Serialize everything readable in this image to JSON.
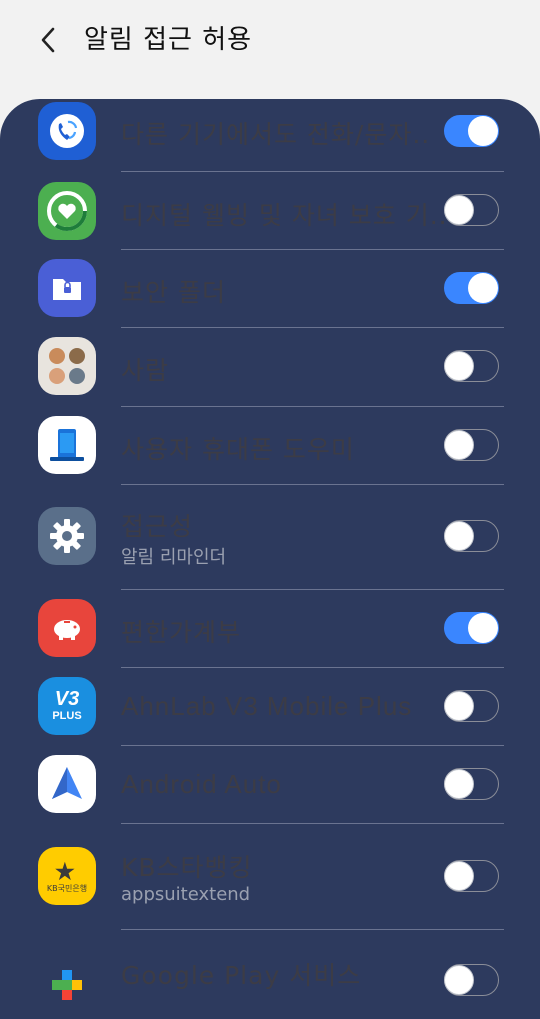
{
  "header": {
    "title": "알림 접근 허용"
  },
  "apps": [
    {
      "name": "다른 기기에서도 전화/문자..",
      "sub": "",
      "enabled": true,
      "icon": "phone-sync-icon",
      "icon_bg": "#1f5fd4"
    },
    {
      "name": "디지털 웰빙 및 자녀 보호 기..",
      "sub": "",
      "enabled": false,
      "icon": "digital-wellbeing-icon",
      "icon_bg": "#4caf50"
    },
    {
      "name": "보안 폴더",
      "sub": "",
      "enabled": true,
      "icon": "secure-folder-icon",
      "icon_bg": "#4a5fd6"
    },
    {
      "name": "사람",
      "sub": "",
      "enabled": false,
      "icon": "people-icon",
      "icon_bg": "#e8e4de"
    },
    {
      "name": "사용자 휴대폰 도우미",
      "sub": "",
      "enabled": false,
      "icon": "phone-helper-icon",
      "icon_bg": "#ffffff"
    },
    {
      "name": "접근성",
      "sub": "알림 리마인더",
      "enabled": false,
      "icon": "settings-gear-icon",
      "icon_bg": "#5a6f8a"
    },
    {
      "name": "편한가계부",
      "sub": "",
      "enabled": true,
      "icon": "piggy-bank-icon",
      "icon_bg": "#e8453c"
    },
    {
      "name": "AhnLab V3 Mobile Plus",
      "sub": "",
      "enabled": false,
      "icon": "v3-plus-icon",
      "icon_bg": "#1a8fe0"
    },
    {
      "name": "Android Auto",
      "sub": "",
      "enabled": false,
      "icon": "android-auto-icon",
      "icon_bg": "#ffffff"
    },
    {
      "name": "KB스타뱅킹",
      "sub": "appsuitextend",
      "enabled": false,
      "icon": "kb-bank-icon",
      "icon_bg": "#ffcc00"
    },
    {
      "name": "Google Play 서비스",
      "sub": "",
      "enabled": false,
      "icon": "google-play-services-icon",
      "icon_bg": "#2d3a5e"
    }
  ],
  "icon_texts": {
    "v3_top": "V3",
    "v3_bottom": "PLUS",
    "kb_bottom": "KB국민은행"
  }
}
